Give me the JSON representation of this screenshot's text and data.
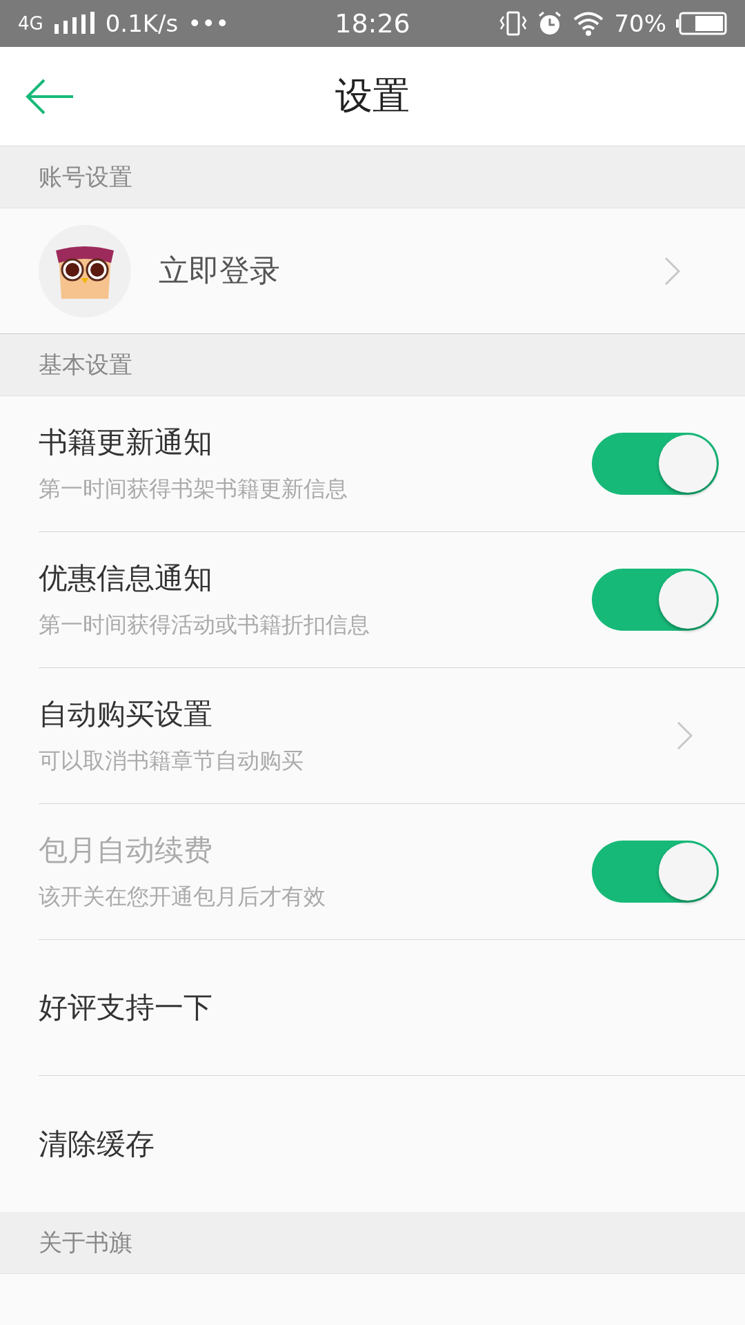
{
  "status_bar": {
    "network": "4G",
    "speed": "0.1K/s",
    "more": "•••",
    "time": "18:26",
    "battery": "70%"
  },
  "header": {
    "title": "设置"
  },
  "sections": [
    {
      "title": "账号设置",
      "items": [
        {
          "kind": "account",
          "title": "立即登录"
        }
      ]
    },
    {
      "title": "基本设置",
      "items": [
        {
          "kind": "toggle",
          "title": "书籍更新通知",
          "subtitle": "第一时间获得书架书籍更新信息",
          "on": true,
          "disabled": false
        },
        {
          "kind": "toggle",
          "title": "优惠信息通知",
          "subtitle": "第一时间获得活动或书籍折扣信息",
          "on": true,
          "disabled": false
        },
        {
          "kind": "link",
          "title": "自动购买设置",
          "subtitle": "可以取消书籍章节自动购买"
        },
        {
          "kind": "toggle",
          "title": "包月自动续费",
          "subtitle": "该开关在您开通包月后才有效",
          "on": true,
          "disabled": true
        },
        {
          "kind": "plain",
          "title": "好评支持一下"
        },
        {
          "kind": "plain",
          "title": "清除缓存"
        }
      ]
    },
    {
      "title": "关于书旗"
    }
  ]
}
